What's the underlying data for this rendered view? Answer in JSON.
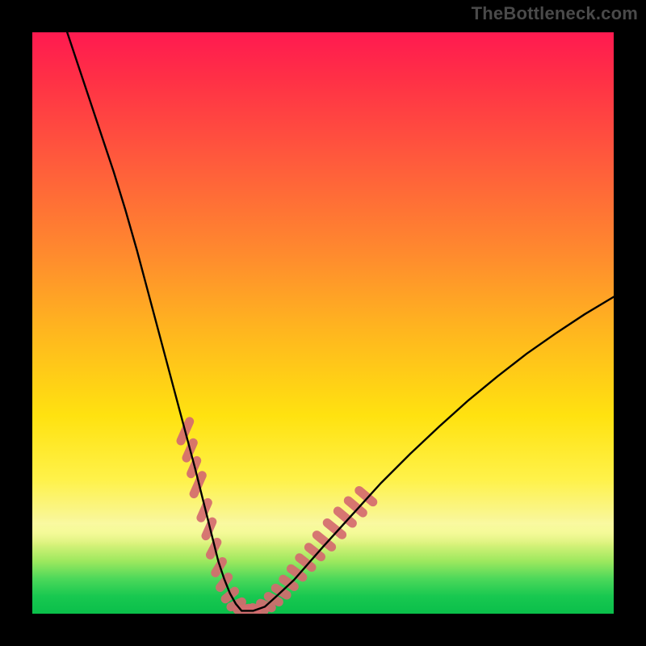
{
  "watermark": "TheBottleneck.com",
  "colors": {
    "curve_black": "#000000",
    "marker_pink": "#d46a6f",
    "green_band": "#0abf4a"
  },
  "chart_data": {
    "type": "line",
    "title": "",
    "xlabel": "",
    "ylabel": "",
    "xlim": [
      0,
      100
    ],
    "ylim": [
      0,
      100
    ],
    "series": [
      {
        "name": "bottleneck-curve",
        "x": [
          6,
          8,
          10,
          12,
          14,
          16,
          18,
          20,
          22,
          24,
          26,
          28,
          29,
          30,
          31,
          32,
          33,
          34,
          35,
          36,
          38,
          40,
          42,
          45,
          50,
          55,
          60,
          65,
          70,
          75,
          80,
          85,
          90,
          95,
          100
        ],
        "y": [
          100,
          94,
          88,
          82,
          76,
          69.5,
          62.5,
          55,
          47.5,
          40,
          32.5,
          25,
          21,
          17,
          13,
          9,
          6,
          3.5,
          1.7,
          0.5,
          0.5,
          1.2,
          3,
          5.8,
          11.5,
          17,
          22.5,
          27.5,
          32.2,
          36.7,
          40.8,
          44.7,
          48.2,
          51.5,
          54.5
        ]
      }
    ],
    "markers": [
      {
        "name": "left-cluster",
        "color": "#d46a6f",
        "points": [
          {
            "x": 26.3,
            "y": 31.4,
            "len": 5.2,
            "angle": -66
          },
          {
            "x": 27.1,
            "y": 28.1,
            "len": 4.4,
            "angle": -66
          },
          {
            "x": 27.8,
            "y": 25.2,
            "len": 4.0,
            "angle": -66
          },
          {
            "x": 28.5,
            "y": 22.2,
            "len": 5.0,
            "angle": -66
          },
          {
            "x": 29.6,
            "y": 17.8,
            "len": 4.4,
            "angle": -66
          },
          {
            "x": 30.4,
            "y": 14.6,
            "len": 4.2,
            "angle": -66
          },
          {
            "x": 31.2,
            "y": 11.2,
            "len": 4.0,
            "angle": -62
          },
          {
            "x": 32.1,
            "y": 8.0,
            "len": 3.8,
            "angle": -58
          },
          {
            "x": 33.0,
            "y": 5.4,
            "len": 3.8,
            "angle": -52
          },
          {
            "x": 34.0,
            "y": 3.2,
            "len": 3.6,
            "angle": -40
          },
          {
            "x": 35.1,
            "y": 1.6,
            "len": 3.6,
            "angle": -25
          },
          {
            "x": 36.3,
            "y": 0.8,
            "len": 3.6,
            "angle": -8
          },
          {
            "x": 37.6,
            "y": 0.6,
            "len": 3.6,
            "angle": 4
          },
          {
            "x": 38.9,
            "y": 0.8,
            "len": 3.6,
            "angle": 14
          },
          {
            "x": 40.2,
            "y": 1.4,
            "len": 3.6,
            "angle": 22
          },
          {
            "x": 41.5,
            "y": 2.5,
            "len": 3.6,
            "angle": 28
          },
          {
            "x": 42.8,
            "y": 3.8,
            "len": 3.8,
            "angle": 32
          },
          {
            "x": 44.1,
            "y": 5.3,
            "len": 3.8,
            "angle": 34
          },
          {
            "x": 45.5,
            "y": 7.0,
            "len": 4.0,
            "angle": 36
          },
          {
            "x": 47.0,
            "y": 8.8,
            "len": 4.2,
            "angle": 38
          },
          {
            "x": 48.6,
            "y": 10.6,
            "len": 4.2,
            "angle": 38
          },
          {
            "x": 50.2,
            "y": 12.5,
            "len": 4.8,
            "angle": 39
          },
          {
            "x": 52.0,
            "y": 14.6,
            "len": 4.8,
            "angle": 39
          },
          {
            "x": 53.8,
            "y": 16.6,
            "len": 4.8,
            "angle": 40
          },
          {
            "x": 55.6,
            "y": 18.4,
            "len": 4.8,
            "angle": 40
          },
          {
            "x": 57.4,
            "y": 20.2,
            "len": 4.6,
            "angle": 40
          }
        ]
      }
    ],
    "annotations": []
  }
}
